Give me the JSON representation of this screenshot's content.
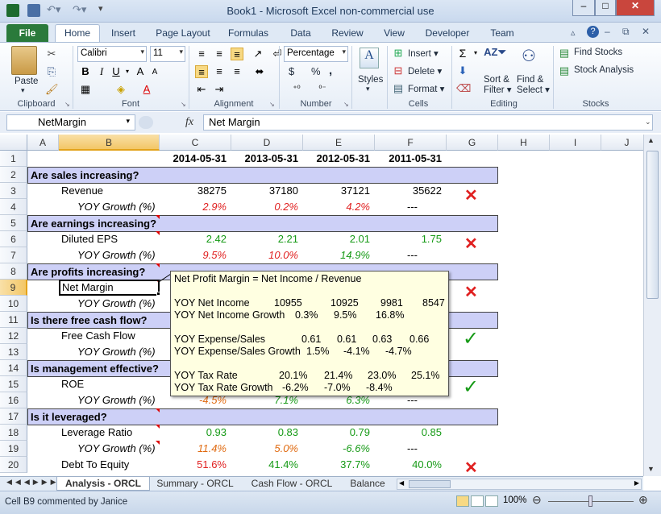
{
  "window": {
    "title": "Book1  -  Microsoft Excel non-commercial use"
  },
  "ribbon_tabs": [
    "File",
    "Home",
    "Insert",
    "Page Layout",
    "Formulas",
    "Data",
    "Review",
    "View",
    "Developer",
    "Team"
  ],
  "ribbon": {
    "clipboard": {
      "label": "Clipboard",
      "paste": "Paste"
    },
    "font": {
      "label": "Font",
      "name": "Calibri",
      "size": "11"
    },
    "alignment": {
      "label": "Alignment"
    },
    "number": {
      "label": "Number",
      "format": "Percentage",
      "symbols": [
        "$",
        "%",
        ","
      ]
    },
    "styles": {
      "label": "Styles"
    },
    "cells": {
      "label": "Cells",
      "insert": "Insert",
      "delete": "Delete",
      "format": "Format"
    },
    "editing": {
      "label": "Editing",
      "sort_filter_1": "Sort &",
      "sort_filter_2": "Filter",
      "find_select_1": "Find &",
      "find_select_2": "Select"
    },
    "stocks": {
      "label": "Stocks",
      "find_stocks": "Find Stocks",
      "stock_analysis": "Stock Analysis"
    }
  },
  "formula_bar": {
    "name_box": "NetMargin",
    "fx": "fx",
    "content": "Net Margin"
  },
  "columns": [
    "A",
    "B",
    "C",
    "D",
    "E",
    "F",
    "G",
    "H",
    "I",
    "J"
  ],
  "rows": [
    "1",
    "2",
    "3",
    "4",
    "5",
    "6",
    "7",
    "8",
    "9",
    "10",
    "11",
    "12",
    "13",
    "14",
    "15",
    "16",
    "17",
    "18",
    "19",
    "20"
  ],
  "sheet": {
    "dates": [
      "2014-05-31",
      "2013-05-31",
      "2012-05-31",
      "2011-05-31"
    ],
    "sections": {
      "s2": "Are sales increasing?",
      "s5": "Are earnings increasing?",
      "s8": "Are profits increasing?",
      "s11": "Is there free cash flow?",
      "s14": "Is management effective?",
      "s17": "Is it leveraged?"
    },
    "labels": {
      "r3": "Revenue",
      "r4": "YOY Growth (%)",
      "r6": "Diluted EPS",
      "r7": "YOY Growth (%)",
      "r9": "Net Margin",
      "r10": "YOY Growth (%)",
      "r12": "Free Cash Flow",
      "r13": "YOY Growth (%)",
      "r15": "ROE",
      "r16": "YOY Growth (%)",
      "r18": "Leverage Ratio",
      "r19": "YOY Growth (%)",
      "r20": "Debt To Equity"
    },
    "values": {
      "r3": [
        "38275",
        "37180",
        "37121",
        "35622"
      ],
      "r4": [
        "2.9%",
        "0.2%",
        "4.2%",
        "---"
      ],
      "r6": [
        "2.42",
        "2.21",
        "2.01",
        "1.75"
      ],
      "r7": [
        "9.5%",
        "10.0%",
        "14.9%",
        "---"
      ],
      "r16": [
        "-4.5%",
        "7.1%",
        "6.3%",
        "---"
      ],
      "r18": [
        "0.93",
        "0.83",
        "0.79",
        "0.85"
      ],
      "r19": [
        "11.4%",
        "5.0%",
        "-6.6%",
        "---"
      ],
      "r20": [
        "51.6%",
        "41.4%",
        "37.7%",
        "40.0%"
      ]
    },
    "marks": {
      "cross": "✕",
      "check": "✓"
    }
  },
  "comment": {
    "l1": "Net Profit Margin = Net Income / Revenue",
    "l3": [
      "YOY Net Income",
      "10955",
      "10925",
      "9981",
      "8547"
    ],
    "l4": [
      "YOY Net Income Growth",
      "0.3%",
      "9.5%",
      "16.8%"
    ],
    "l6": [
      "YOY Expense/Sales",
      "0.61",
      "0.61",
      "0.63",
      "0.66"
    ],
    "l7": [
      "YOY Expense/Sales Growth",
      "1.5%",
      "-4.1%",
      "-4.7%"
    ],
    "l9": [
      "YOY Tax Rate",
      "20.1%",
      "21.4%",
      "23.0%",
      "25.1%"
    ],
    "l10": [
      "YOY Tax Rate Growth",
      "-6.2%",
      "-7.0%",
      "-8.4%"
    ]
  },
  "sheet_tabs": [
    "Analysis - ORCL",
    "Summary - ORCL",
    "Cash Flow - ORCL",
    "Balance"
  ],
  "status": {
    "text": "Cell B9 commented by Janice",
    "zoom": "100%"
  },
  "colors": {
    "section_fill": "#cdd0f7",
    "red": "#e02020",
    "green": "#169a16",
    "orange": "#e06a10",
    "file_tab": "#2a7a3b"
  }
}
